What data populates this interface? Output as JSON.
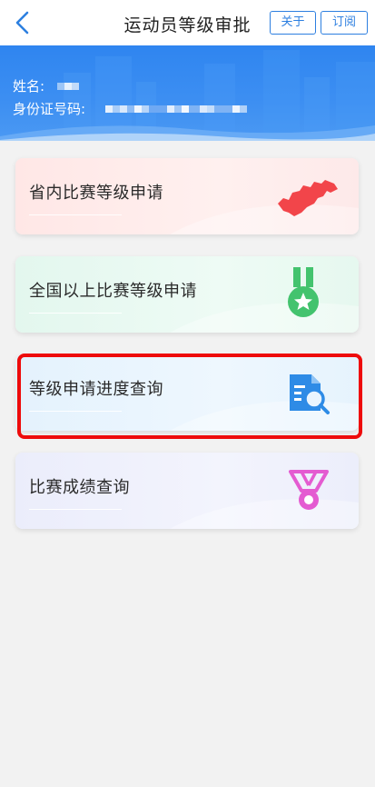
{
  "header": {
    "title": "运动员等级审批",
    "about_label": "关于",
    "subscribe_label": "订阅"
  },
  "profile": {
    "name_label": "姓名:",
    "id_label": "身份证号码:"
  },
  "menu": [
    {
      "label": "省内比赛等级申请",
      "icon": "province-map-icon"
    },
    {
      "label": "全国以上比赛等级申请",
      "icon": "medal-star-icon"
    },
    {
      "label": "等级申请进度查询",
      "icon": "document-search-icon"
    },
    {
      "label": "比赛成绩查询",
      "icon": "ribbon-medal-icon"
    }
  ],
  "colors": {
    "accent": "#2d7fe0",
    "banner": "#3d8ff2",
    "highlight": "#ee0b0b",
    "icon_red": "#f2454a",
    "icon_green": "#43c36e",
    "icon_blue": "#2e8be6",
    "icon_pink": "#e45bd1"
  }
}
